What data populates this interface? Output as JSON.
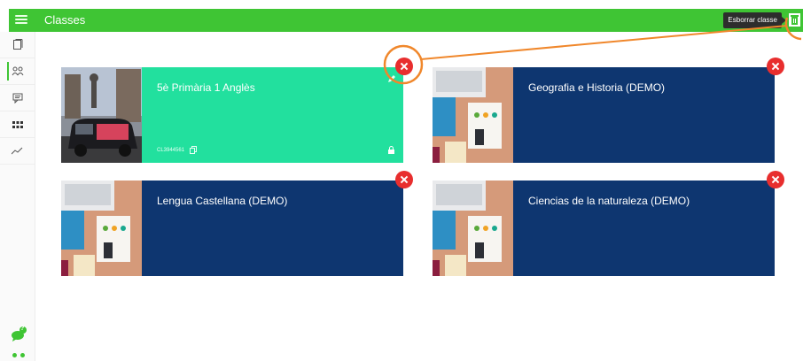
{
  "header": {
    "title": "Classes",
    "tooltip": "Esborrar classe",
    "menu_icon": "hamburger-icon",
    "action_icon": "trash-icon"
  },
  "sidebar": {
    "items": [
      {
        "icon": "book-icon"
      },
      {
        "icon": "students-icon"
      },
      {
        "icon": "message-icon"
      },
      {
        "icon": "apps-grid-icon"
      },
      {
        "icon": "analytics-icon"
      }
    ],
    "chat_badge": "?"
  },
  "classes": [
    {
      "title": "5è Primària 1 Anglès",
      "code": "CL3944561",
      "color": "#22e09e",
      "thumb": "taxi-photo"
    },
    {
      "title": "Geografia e Historia (DEMO)",
      "code": "",
      "color": "#0e3670",
      "thumb": "desk-photo"
    },
    {
      "title": "Lengua Castellana (DEMO)",
      "code": "",
      "color": "#0e3670",
      "thumb": "desk-photo"
    },
    {
      "title": "Ciencias de la naturaleza (DEMO)",
      "code": "",
      "color": "#0e3670",
      "thumb": "desk-photo"
    }
  ],
  "colors": {
    "brand": "#3fc534",
    "delete": "#e82e2e",
    "annotation": "#f0872b"
  }
}
